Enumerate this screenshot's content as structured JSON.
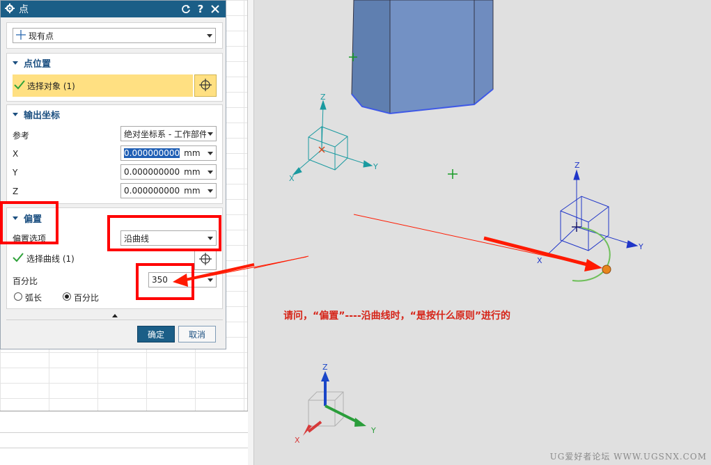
{
  "dialog": {
    "title": "点",
    "type_selector": "现有点",
    "sections": {
      "point_location": "点位置",
      "output_coords": "输出坐标",
      "offset": "偏置"
    },
    "select_object": "选择对象 (1)",
    "reference_label": "参考",
    "reference_value": "绝对坐标系 - 工作部件",
    "x_label": "X",
    "y_label": "Y",
    "z_label": "Z",
    "x_value": "0.000000000",
    "y_value": "0.000000000",
    "z_value": "0.000000000",
    "unit": "mm",
    "offset_option_label": "偏置选项",
    "offset_option_value": "沿曲线",
    "select_curve": "选择曲线 (1)",
    "percent_label": "百分比",
    "percent_value": "350",
    "radio_arc": "弧长",
    "radio_percent": "百分比",
    "ok": "确定",
    "cancel": "取消"
  },
  "viewport": {
    "question": "请问，“偏置”----沿曲线时，“是按什么原则”进行的",
    "watermark": "UG爱好者论坛 WWW.UGSNX.COM",
    "axes": {
      "x": "X",
      "y": "Y",
      "z": "Z"
    }
  },
  "colors": {
    "titlebar": "#1b5e87",
    "highlight": "#ffe082",
    "annotation": "#ff0000",
    "solid": "#7391c4"
  },
  "icons": [
    "gear-icon",
    "reset-icon",
    "help-icon",
    "close-icon",
    "crosshair-icon",
    "check-icon",
    "plus-icon",
    "collapse-icon"
  ]
}
